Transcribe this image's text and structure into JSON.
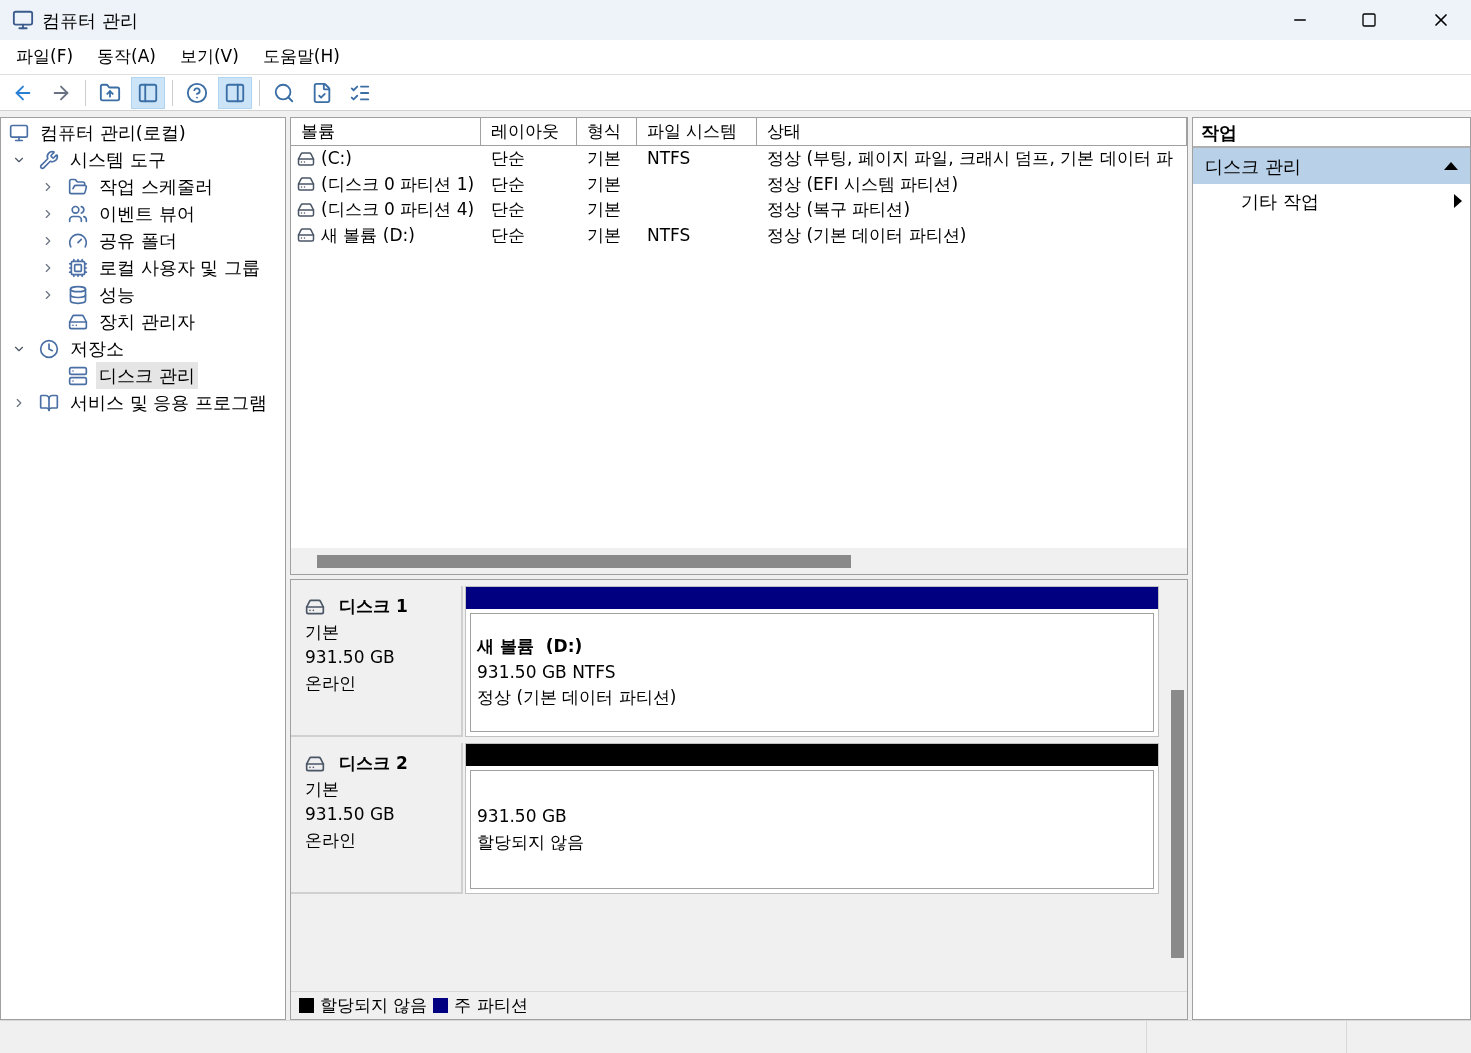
{
  "window": {
    "title": "컴퓨터 관리"
  },
  "menu": [
    "파일(F)",
    "동작(A)",
    "보기(V)",
    "도움말(H)"
  ],
  "toolbar": [
    {
      "kind": "button",
      "pressed": false
    },
    {
      "kind": "button",
      "pressed": false
    },
    {
      "kind": "separator"
    },
    {
      "kind": "button",
      "pressed": false
    },
    {
      "kind": "button",
      "pressed": true
    },
    {
      "kind": "separator"
    },
    {
      "kind": "button",
      "pressed": false
    },
    {
      "kind": "button",
      "pressed": true
    },
    {
      "kind": "separator"
    },
    {
      "kind": "button",
      "pressed": false
    },
    {
      "kind": "button",
      "pressed": false
    },
    {
      "kind": "button",
      "pressed": false
    }
  ],
  "tree": [
    {
      "label": "컴퓨터 관리(로컬)",
      "selected": false,
      "children": [
        {
          "label": "시스템 도구",
          "selected": false,
          "expanded": true,
          "children": [
            {
              "label": "작업 스케줄러",
              "selected": false,
              "expanded": false
            },
            {
              "label": "이벤트 뷰어",
              "selected": false,
              "expanded": false
            },
            {
              "label": "공유 폴더",
              "selected": false,
              "expanded": false
            },
            {
              "label": "로컬 사용자 및 그룹",
              "selected": false,
              "expanded": false
            },
            {
              "label": "성능",
              "selected": false,
              "expanded": false
            },
            {
              "label": "장치 관리자",
              "selected": false
            }
          ]
        },
        {
          "label": "저장소",
          "selected": false,
          "expanded": true,
          "children": [
            {
              "label": "디스크 관리",
              "selected": true
            }
          ]
        },
        {
          "label": "서비스 및 응용 프로그램",
          "selected": false,
          "expanded": false
        }
      ]
    }
  ],
  "table": {
    "columns": [
      "볼륨",
      "레이아웃",
      "형식",
      "파일 시스템",
      "상태"
    ],
    "rows": [
      [
        "(C:)",
        "단순",
        "기본",
        "NTFS",
        "정상 (부팅, 페이지 파일, 크래시 덤프, 기본 데이터 파"
      ],
      [
        "(디스크 0 파티션 1)",
        "단순",
        "기본",
        "",
        "정상 (EFI 시스템 파티션)"
      ],
      [
        "(디스크 0 파티션 4)",
        "단순",
        "기본",
        "",
        "정상 (복구 파티션)"
      ],
      [
        "새 볼륨 (D:)",
        "단순",
        "기본",
        "NTFS",
        "정상 (기본 데이터 파티션)"
      ]
    ]
  },
  "disks": [
    {
      "name": "디스크 1",
      "type": "기본",
      "size": "931.50 GB",
      "status": "온라인",
      "partitions": [
        {
          "color": "#000080",
          "name": "새 볼륨  (D:)",
          "size": "931.50 GB NTFS",
          "status": "정상 (기본 데이터 파티션)"
        }
      ]
    },
    {
      "name": "디스크 2",
      "type": "기본",
      "size": "931.50 GB",
      "status": "온라인",
      "partitions": [
        {
          "color": "#000000",
          "size": "931.50 GB",
          "status": "할당되지 않음"
        }
      ]
    }
  ],
  "legend": [
    {
      "color": "#000000",
      "label": "할당되지 않음"
    },
    {
      "color": "#000080",
      "label": "주 파티션"
    }
  ],
  "actions": {
    "title": "작업",
    "sections": [
      {
        "label": "디스크 관리",
        "expanded": true,
        "items": [
          "기타 작업"
        ]
      }
    ]
  }
}
